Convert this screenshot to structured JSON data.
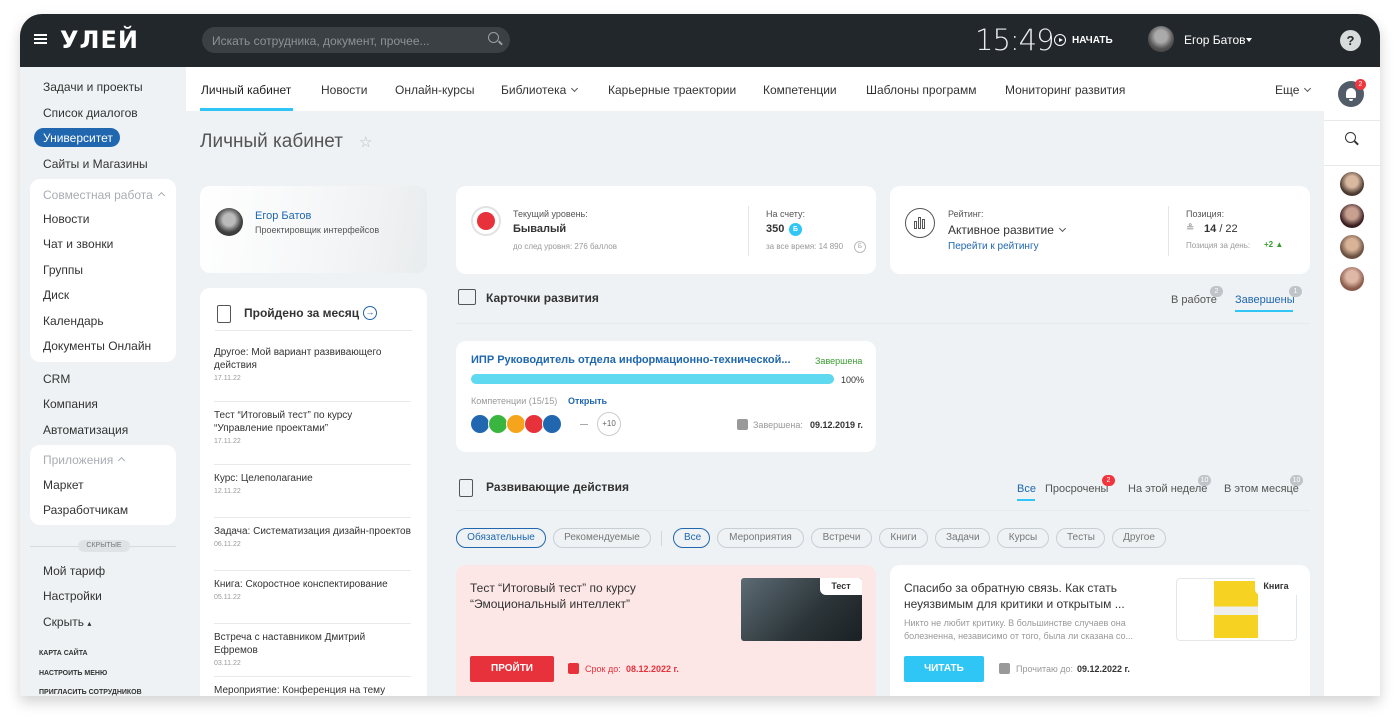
{
  "app": {
    "logo": "УЛЕЙ",
    "search_placeholder": "Искать сотрудника, документ, прочее...",
    "clock": "15:49",
    "start_label": "НАЧАТЬ",
    "user_name": "Егор Батов",
    "help": "?",
    "notif_count": "2"
  },
  "sidebar": {
    "top_items": [
      "Задачи и проекты",
      "Список диалогов",
      "Университет",
      "Сайты и Магазины"
    ],
    "group1_title": "Совместная работа",
    "group1_items": [
      "Новости",
      "Чат и звонки",
      "Группы",
      "Диск",
      "Календарь",
      "Документы Онлайн"
    ],
    "mid_items": [
      "CRM",
      "Компания",
      "Автоматизация"
    ],
    "group2_title": "Приложения",
    "group2_items": [
      "Маркет",
      "Разработчикам"
    ],
    "hidden_label": "СКРЫТЫЕ",
    "bottom_items": [
      "Мой тариф",
      "Настройки",
      "Скрыть"
    ],
    "footer_links": [
      "КАРТА САЙТА",
      "НАСТРОИТЬ МЕНЮ",
      "ПРИГЛАСИТЬ СОТРУДНИКОВ"
    ]
  },
  "tabs": [
    "Личный кабинет",
    "Новости",
    "Онлайн-курсы",
    "Библиотека",
    "Карьерные траектории",
    "Компетенции",
    "Шаблоны программ",
    "Мониторинг развития",
    "Еще"
  ],
  "page_title": "Личный кабинет",
  "profile": {
    "name": "Егор Батов",
    "role": "Проектировщик интерфейсов"
  },
  "month": {
    "title": "Пройдено за месяц",
    "items": [
      {
        "text": "Другое: Мой вариант развивающего действия",
        "date": "17.11.22"
      },
      {
        "text": "Тест “Итоговый тест” по курсу “Управление проектами”",
        "date": "17.11.22"
      },
      {
        "text": "Курс: Целеполагание",
        "date": "12.11.22"
      },
      {
        "text": "Задача: Систематизация дизайн-проектов",
        "date": "06.11.22"
      },
      {
        "text": "Книга: Скоростное конспектирование",
        "date": "05.11.22"
      },
      {
        "text": "Встреча с наставником Дмитрий Ефремов",
        "date": "03.11.22"
      },
      {
        "text": "Мероприятие: Конференция на тему \"Работа в коллективе\"",
        "date": ""
      }
    ]
  },
  "level": {
    "label": "Текущий уровень:",
    "value": "Бывалый",
    "next": "до след уровня: 276 баллов",
    "acc_label": "На счету:",
    "acc_value": "350",
    "acc_total": "за все время: 14 890"
  },
  "rating": {
    "label": "Рейтинг:",
    "value": "Активное развитие",
    "link": "Перейти к рейтингу",
    "pos_label": "Позиция:",
    "pos_value": "14",
    "pos_total": "/ 22",
    "pos_day": "Позиция за день:",
    "pos_delta": "+2"
  },
  "cards": {
    "title": "Карточки развития",
    "tab_work": "В работе",
    "tab_work_count": "2",
    "tab_done": "Завершены",
    "tab_done_count": "1",
    "card": {
      "title": "ИПР Руководитель отдела информационно-технической...",
      "status": "Завершена",
      "progress": 1.0,
      "percent": "100%",
      "comp_label": "Компетенции (15/15)",
      "open": "Открыть",
      "more": "+10",
      "done_label": "Завершена:",
      "done_date": "09.12.2019 г."
    }
  },
  "actions": {
    "title": "Развивающие действия",
    "filters": [
      "Все",
      "Просрочены",
      "На этой неделе",
      "В этом месяце"
    ],
    "counts": [
      "",
      "2",
      "10",
      "10"
    ],
    "chips": [
      "Обязательные",
      "Рекомендуемые",
      "Все",
      "Мероприятия",
      "Встречи",
      "Книги",
      "Задачи",
      "Курсы",
      "Тесты",
      "Другое"
    ],
    "a1": {
      "title": "Тест “Итоговый тест” по курсу “Эмоциональный интеллект”",
      "tag": "Тест",
      "btn": "ПРОЙТИ",
      "due_label": "Срок до:",
      "due": "08.12.2022 г."
    },
    "a2": {
      "title": "Спасибо за обратную связь. Как стать неуязвимым для критики и открытым ...",
      "desc": "Никто не любит критику. В большинстве случаев она болезненна, независимо от того, была ли сказана со...",
      "tag": "Книга",
      "btn": "ЧИТАТЬ",
      "read_label": "Прочитаю до:",
      "read": "09.12.2022 г."
    }
  },
  "colors": {
    "accent": "#2fc6f6",
    "brand": "#2067b0",
    "topbar": "#22272b",
    "danger": "#f2343d"
  }
}
